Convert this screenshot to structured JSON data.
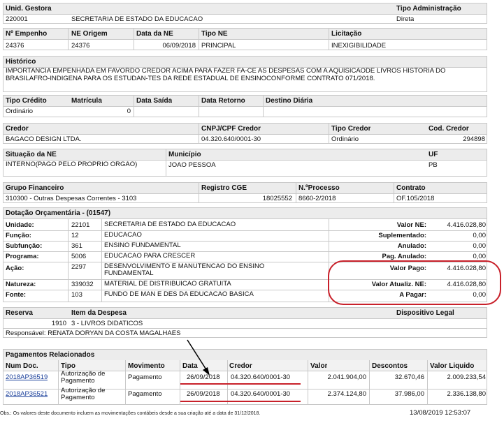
{
  "gestora": {
    "h_unid": "Unid. Gestora",
    "h_tipo_adm": "Tipo Administração",
    "codigo": "220001",
    "nome": "SECRETARIA DE ESTADO DA EDUCACAO",
    "tipo_adm": "Direta"
  },
  "empenho": {
    "h_num": "Nº Empenho",
    "h_origem": "NE Origem",
    "h_data": "Data da NE",
    "h_tipo": "Tipo NE",
    "h_licit": "Licitação",
    "num": "24376",
    "origem": "24376",
    "data": "06/09/2018",
    "tipo": "PRINCIPAL",
    "licit": "INEXIGIBILIDADE"
  },
  "historico": {
    "h": "Histórico",
    "texto": "IMPORTANCIA EMPENHADA EM FAVORDO CREDOR ACIMA PARA FAZER FA-CE AS DESPESAS COM A AQUISICAODE LIVROS HISTORIA DO  BRASILAFRO-INDIGENA PARA OS ESTUDAN-TES DA REDE ESTADUAL DE ENSINOCONFORME CONTRATO 071/2018."
  },
  "credito": {
    "h_tipo": "Tipo Crédito",
    "h_matr": "Matrícula",
    "h_saida": "Data Saída",
    "h_retorno": "Data Retorno",
    "h_destino": "Destino Diária",
    "tipo": "Ordinário",
    "matr": "0"
  },
  "credor": {
    "h_credor": "Credor",
    "h_cnpj": "CNPJ/CPF Credor",
    "h_tipo": "Tipo Credor",
    "h_cod": "Cod. Credor",
    "nome": "BAGACO DESIGN LTDA.",
    "cnpj": "04.320.640/0001-30",
    "tipo": "Ordinário",
    "cod": "294898"
  },
  "situacao": {
    "h_sit": "Situação da NE",
    "h_mun": "Município",
    "h_uf": "UF",
    "sit": "INTERNO(PAGO PELO PROPRIO ÓRGÃO)",
    "mun": "JOAO PESSOA",
    "uf": "PB"
  },
  "grupo": {
    "h_grupo": "Grupo Financeiro",
    "h_cge": "Registro CGE",
    "h_proc": "N.ºProcesso",
    "h_contrato": "Contrato",
    "grupo": "310300 - Outras Despesas Correntes - 3103",
    "cge": "18025552",
    "proc": "8660-2/2018",
    "contrato": "OF.105/2018"
  },
  "dotacao": {
    "h": "Dotação Orçamentária - (01547)",
    "rows": [
      {
        "label": "Unidade:",
        "code": "22101",
        "desc": "SECRETARIA DE ESTADO DA EDUCACAO",
        "vlabel": "Valor NE:",
        "value": "4.416.028,80"
      },
      {
        "label": "Função:",
        "code": "12",
        "desc": "EDUCACAO",
        "vlabel": "Suplementado:",
        "value": "0,00"
      },
      {
        "label": "Subfunção:",
        "code": "361",
        "desc": "ENSINO FUNDAMENTAL",
        "vlabel": "Anulado:",
        "value": "0,00"
      },
      {
        "label": "Programa:",
        "code": "5006",
        "desc": "EDUCACAO PARA CRESCER",
        "vlabel": "Pag. Anulado:",
        "value": "0,00"
      },
      {
        "label": "Ação:",
        "code": "2297",
        "desc": "DESENVOLVIMENTO E MANUTENCAO DO ENSINO FUNDAMENTAL",
        "vlabel": "Valor Pago:",
        "value": "4.416.028,80"
      },
      {
        "label": "Natureza:",
        "code": "339032",
        "desc": "MATERIAL DE DISTRIBUICAO GRATUITA",
        "vlabel": "Valor Atualiz. NE:",
        "value": "4.416.028,80"
      },
      {
        "label": "Fonte:",
        "code": "103",
        "desc": "FUNDO DE MAN E DES DA EDUCACAO BASICA",
        "vlabel": "A Pagar:",
        "value": "0,00"
      }
    ]
  },
  "reserva": {
    "h_reserva": "Reserva",
    "h_item": "Item da Despesa",
    "h_disp": "Dispositivo Legal",
    "reserva": "1910",
    "item": "3 - LIVROS DIDATICOS",
    "responsavel": "Responsável: RENATA DORYAN DA COSTA MAGALHAES"
  },
  "pagamentos": {
    "h": "Pagamentos Relacionados",
    "cols": [
      "Num  Doc.",
      "Tipo",
      "Movimento",
      "Data",
      "Credor",
      "Valor",
      "Descontos",
      "Valor Liquido"
    ],
    "rows": [
      {
        "doc": "2018AP36519",
        "tipo": "Autorização de Pagamento",
        "mov": "Pagamento",
        "data": "26/09/2018",
        "credor": "04.320.640/0001-30",
        "valor": "2.041.904,00",
        "desc": "32.670,46",
        "liq": "2.009.233,54"
      },
      {
        "doc": "2018AP36521",
        "tipo": "Autorização de Pagamento",
        "mov": "Pagamento",
        "data": "26/09/2018",
        "credor": "04.320.640/0001-30",
        "valor": "2.374.124,80",
        "desc": "37.986,00",
        "liq": "2.336.138,80"
      }
    ]
  },
  "footer": {
    "obs": "Obs.: Os valores deste documento incluem as movimentações contábeis desde a sua criação até a data de 31/12/2018.",
    "timestamp": "13/08/2019 12:53:07"
  }
}
